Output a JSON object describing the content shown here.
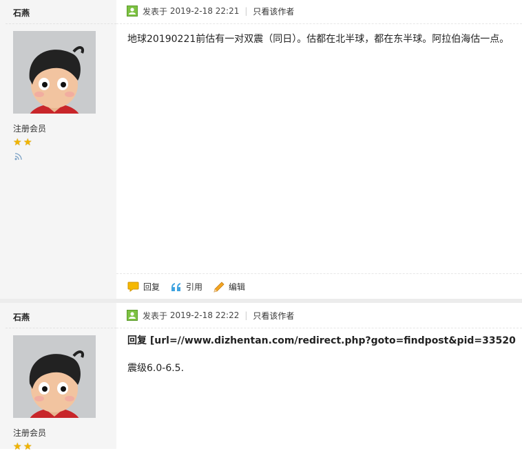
{
  "posts": [
    {
      "author": "石燕",
      "group": "注册会员",
      "meta_prefix": "发表于",
      "date": "2019-2-18 22:21",
      "author_only": "只看该作者",
      "lines": [
        "地球20190221前估有一对双震（同日）。估都在北半球，都在东半球。阿拉伯海估一点。"
      ],
      "actions": {
        "reply": "回复",
        "quote": "引用",
        "edit": "编辑"
      }
    },
    {
      "author": "石燕",
      "group": "注册会员",
      "meta_prefix": "发表于",
      "date": "2019-2-18 22:22",
      "author_only": "只看该作者",
      "quote_line": "回复 [url=//www.dizhentan.com/redirect.php?goto=findpost&pid=33520",
      "lines": [
        "震级6.0-6.5."
      ]
    }
  ],
  "colors": {
    "star": "#f0b400",
    "sidebar": "#f5f5f5",
    "online": "#6ab92a"
  }
}
